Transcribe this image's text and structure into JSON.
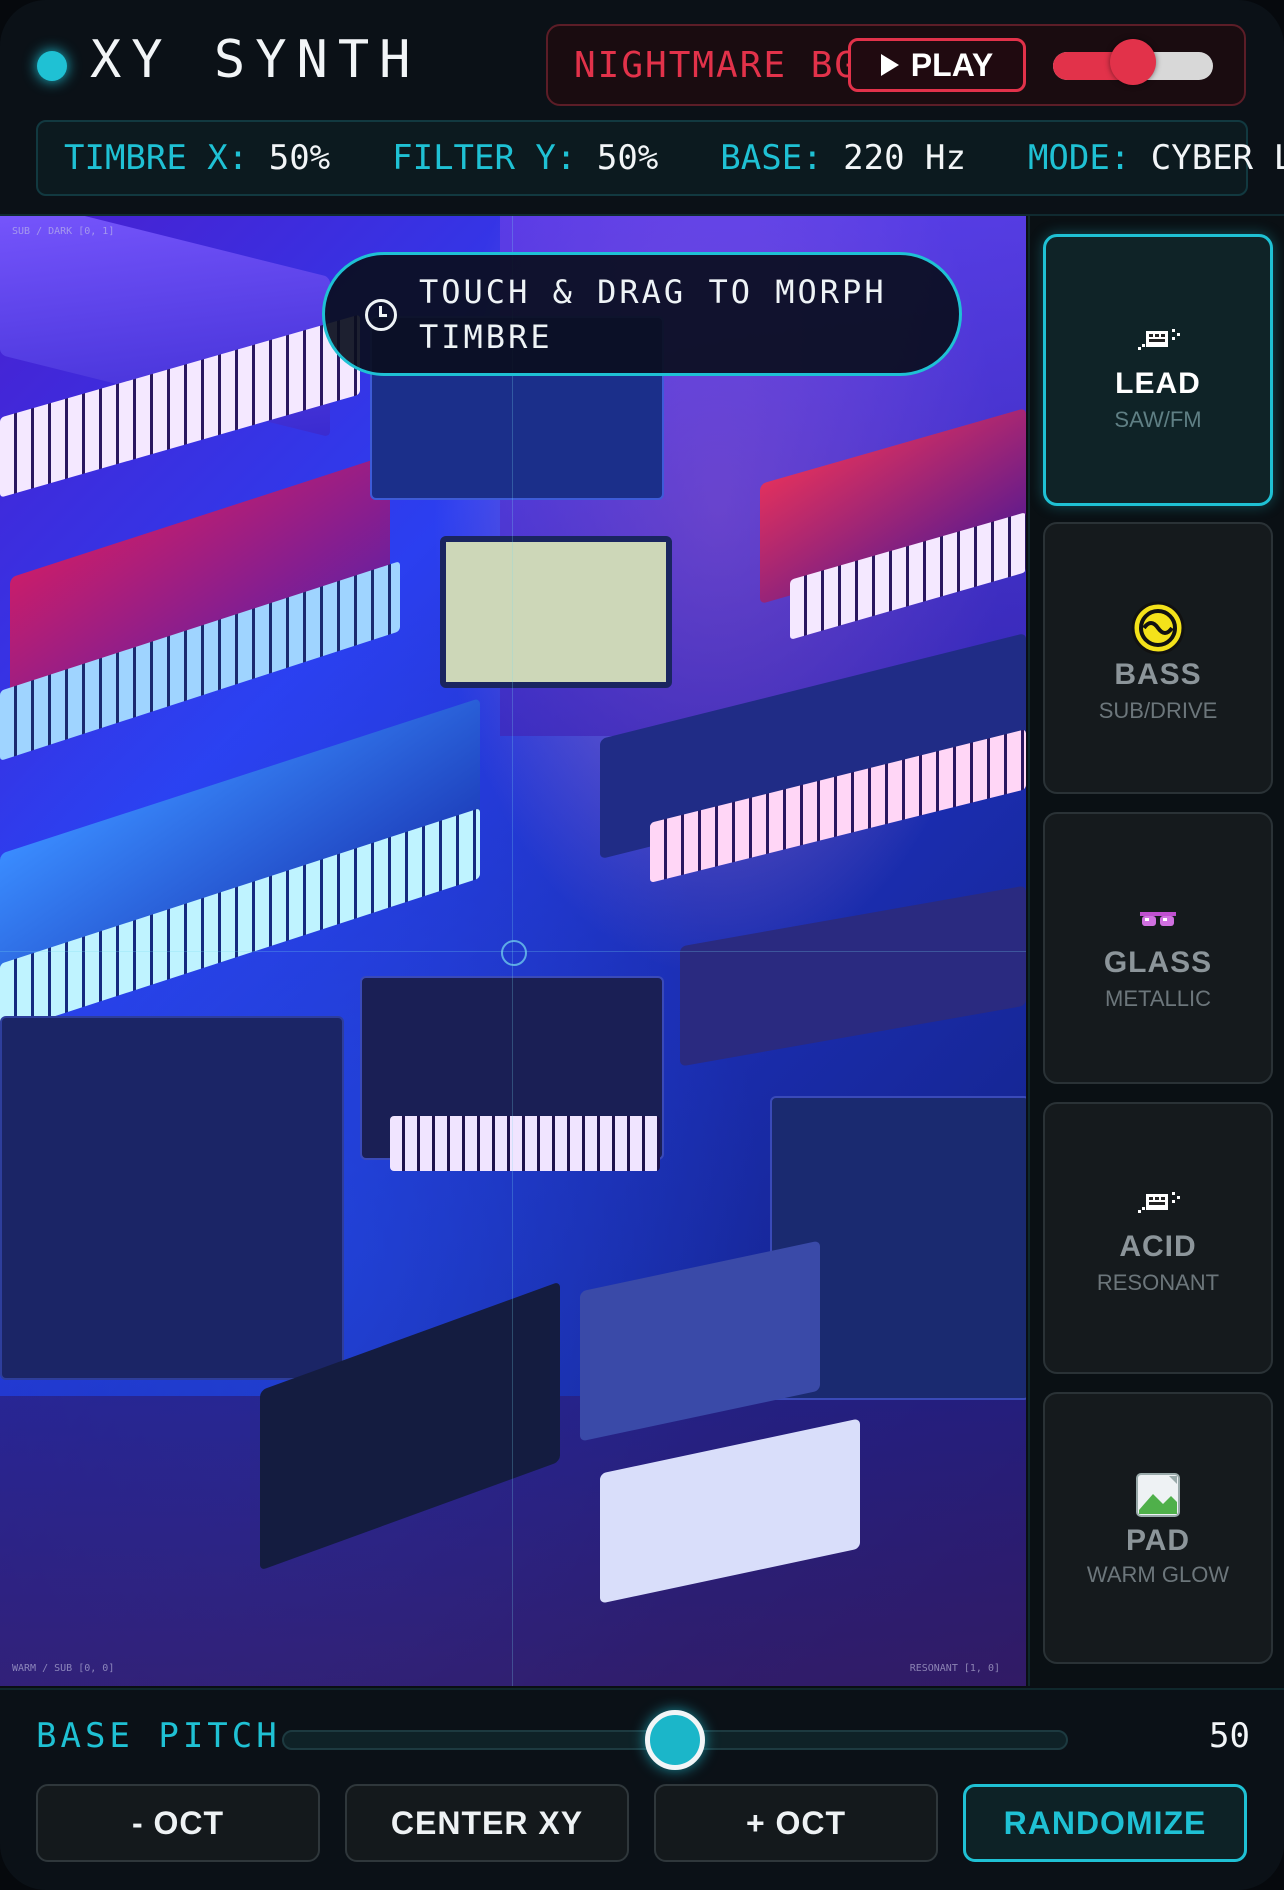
{
  "header": {
    "title": "XY SYNTH",
    "bgm_label": "NIGHTMARE BGM",
    "play_label": "PLAY",
    "volume": 0.5
  },
  "readout": {
    "timbre_key": "TIMBRE X:",
    "timbre_val": "50%",
    "filter_key": "FILTER Y:",
    "filter_val": "50%",
    "base_key": "BASE:",
    "base_val": "220 Hz",
    "mode_key": "MODE:",
    "mode_val": "CYBER LEAD"
  },
  "pad": {
    "hint_line1": "TOUCH & DRAG TO MORPH",
    "hint_line2": "TIMBRE",
    "corner_top_left": "SUB / DARK [0, 1]",
    "corner_bottom_left": "WARM / SUB [0, 0]",
    "corner_bottom_right": "RESONANT [1, 0]",
    "background": "synthesizer studio photo with purple/blue lighting"
  },
  "modes": [
    {
      "name": "LEAD",
      "sub": "SAW/FM",
      "icon": "keyboard-sparkle-icon",
      "active": true
    },
    {
      "name": "BASS",
      "sub": "SUB/DRIVE",
      "icon": "wave-circle-icon",
      "active": false
    },
    {
      "name": "GLASS",
      "sub": "METALLIC",
      "icon": "glasses-icon",
      "active": false
    },
    {
      "name": "ACID",
      "sub": "RESONANT",
      "icon": "keyboard-sparkle-icon",
      "active": false
    },
    {
      "name": "PAD",
      "sub": "WARM GLOW",
      "icon": "broken-image-icon",
      "active": false
    }
  ],
  "bottom": {
    "base_pitch_label": "BASE PITCH",
    "base_pitch_value": "50",
    "base_pitch_fraction": 0.5,
    "buttons": [
      "- OCT",
      "CENTER XY",
      "+ OCT",
      "RANDOMIZE"
    ]
  },
  "colors": {
    "accent": "#1fc1d4",
    "danger": "#e2324a",
    "background": "#0a0f14"
  }
}
